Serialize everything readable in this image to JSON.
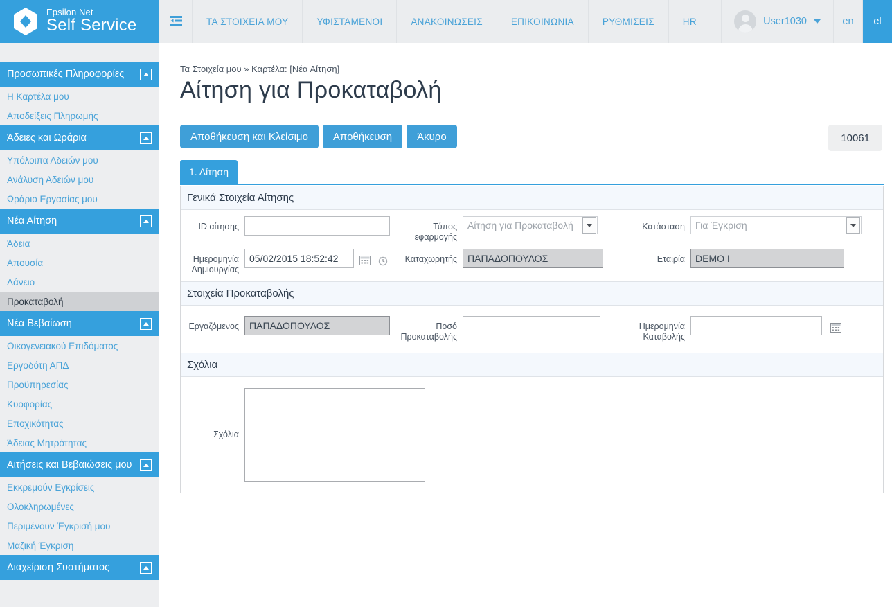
{
  "brand": {
    "line1": "Epsilon Net",
    "line2": "Self Service",
    "logo_icon": "hexagon-diamond-logo"
  },
  "header": {
    "sidebar_toggle_icon": "collapse-sidebar-icon",
    "nav": [
      {
        "label": "ΤΑ ΣΤΟΙΧΕΙΑ ΜΟΥ"
      },
      {
        "label": "ΥΦΙΣΤΑΜΕΝΟΙ"
      },
      {
        "label": "ΑΝΑΚΟΙΝΩΣΕΙΣ"
      },
      {
        "label": "ΕΠΙΚΟΙΝΩΝΙΑ"
      },
      {
        "label": "ΡΥΘΜΙΣΕΙΣ"
      },
      {
        "label": "HR"
      }
    ],
    "user": {
      "name": "User1030",
      "avatar_icon": "user-avatar-icon",
      "caret_icon": "chevron-down-icon"
    },
    "lang_inactive": "en",
    "lang_active": "el",
    "accent": "#35a0dd"
  },
  "sidebar": {
    "groups": [
      {
        "title": "Προσωπικές Πληροφορίες",
        "collapse_icon": "chevron-up-icon",
        "items": [
          {
            "label": "Η Καρτέλα μου",
            "active": false
          },
          {
            "label": "Αποδείξεις Πληρωμής",
            "active": false
          }
        ]
      },
      {
        "title": "Άδειες και Ωράρια",
        "collapse_icon": "chevron-up-icon",
        "items": [
          {
            "label": "Υπόλοιπα Αδειών μου",
            "active": false
          },
          {
            "label": "Ανάλυση Αδειών μου",
            "active": false
          },
          {
            "label": "Ωράριο Εργασίας μου",
            "active": false
          }
        ]
      },
      {
        "title": "Νέα Αίτηση",
        "collapse_icon": "chevron-up-icon",
        "items": [
          {
            "label": "Άδεια",
            "active": false
          },
          {
            "label": "Απουσία",
            "active": false
          },
          {
            "label": "Δάνειο",
            "active": false
          },
          {
            "label": "Προκαταβολή",
            "active": true
          }
        ]
      },
      {
        "title": "Νέα Βεβαίωση",
        "collapse_icon": "chevron-up-icon",
        "items": [
          {
            "label": "Οικογενειακού Επιδόματος",
            "active": false
          },
          {
            "label": "Εργοδότη ΑΠΔ",
            "active": false
          },
          {
            "label": "Προϋπηρεσίας",
            "active": false
          },
          {
            "label": "Κυοφορίας",
            "active": false
          },
          {
            "label": "Εποχικότητας",
            "active": false
          },
          {
            "label": "Άδειας Μητρότητας",
            "active": false
          }
        ]
      },
      {
        "title": "Αιτήσεις και Βεβαιώσεις μου",
        "collapse_icon": "chevron-up-icon",
        "items": [
          {
            "label": "Εκκρεμούν Εγκρίσεις",
            "active": false
          },
          {
            "label": "Ολοκληρωμένες",
            "active": false
          },
          {
            "label": "Περιμένουν Έγκρισή μου",
            "active": false
          },
          {
            "label": "Μαζική Έγκριση",
            "active": false
          }
        ]
      },
      {
        "title": "Διαχείριση Συστήματος",
        "collapse_icon": "chevron-up-icon",
        "items": []
      }
    ]
  },
  "main": {
    "breadcrumb": "Τα Στοιχεία μου » Καρτέλα: [Νέα Αίτηση]",
    "title": "Αίτηση για Προκαταβολή",
    "buttons": {
      "save_and_close": "Αποθήκευση και Κλείσιμο",
      "save": "Αποθήκευση",
      "cancel": "Άκυρο"
    },
    "record_id": "10061",
    "tabs": [
      {
        "label": "1. Αίτηση",
        "active": true
      }
    ],
    "sections": [
      {
        "title": "Γενικά Στοιχεία Αίτησης",
        "fields": {
          "request_id": {
            "label": "ID αίτησης",
            "value": "",
            "placeholder": ""
          },
          "app_type": {
            "label": "Τύπος εφαρμογής",
            "value": "Αίτηση για Προκαταβολή",
            "dropdown_icon": "caret-down-icon"
          },
          "status": {
            "label": "Κατάσταση",
            "value": "Για Έγκριση",
            "dropdown_icon": "caret-down-icon"
          },
          "created_date": {
            "label": "Ημερομηνία Δημιουργίας",
            "value": "05/02/2015 18:52:42",
            "calendar_icon": "calendar-icon",
            "clock_icon": "clock-icon"
          },
          "registrar": {
            "label": "Καταχωρητής",
            "value": "ΠΑΠΑΔΟΠΟΥΛΟΣ"
          },
          "company": {
            "label": "Εταιρία",
            "value": "DEMO I"
          }
        }
      },
      {
        "title": "Στοιχεία Προκαταβολής",
        "fields": {
          "employee": {
            "label": "Εργαζόμενος",
            "value": "ΠΑΠΑΔΟΠΟΥΛΟΣ"
          },
          "advance_amount": {
            "label": "Ποσό Προκαταβολής",
            "value": "",
            "placeholder": ""
          },
          "payment_date": {
            "label": "Ημερομηνία Καταβολής",
            "value": "",
            "calendar_icon": "calendar-icon"
          }
        }
      },
      {
        "title": "Σχόλια",
        "fields": {
          "comments": {
            "label": "Σχόλια",
            "value": "",
            "placeholder": ""
          }
        }
      }
    ]
  }
}
